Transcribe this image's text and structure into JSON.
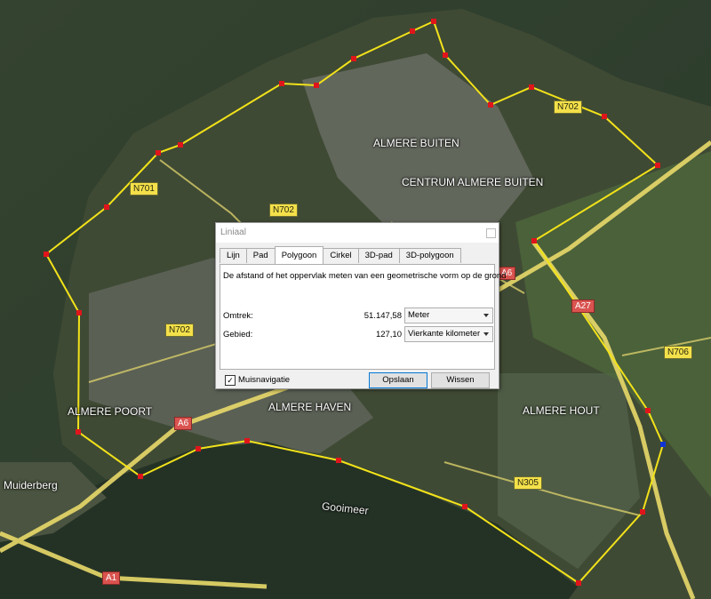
{
  "map": {
    "places": [
      {
        "id": "almere-buiten",
        "text": "ALMERE BUITEN"
      },
      {
        "id": "centrum-almere-buiten",
        "text": "CENTRUM ALMERE BUITEN"
      },
      {
        "id": "almere-poort",
        "text": "ALMERE POORT"
      },
      {
        "id": "almere-haven",
        "text": "ALMERE HAVEN"
      },
      {
        "id": "almere-hout",
        "text": "ALMERE HOUT"
      },
      {
        "id": "muiderberg",
        "text": "Muiderberg"
      },
      {
        "id": "gooimeer",
        "text": "Gooimeer"
      }
    ],
    "roads": [
      {
        "id": "n701",
        "text": "N701"
      },
      {
        "id": "n702-a",
        "text": "N702"
      },
      {
        "id": "n702-b",
        "text": "N702"
      },
      {
        "id": "n702-c",
        "text": "N702"
      },
      {
        "id": "a6-a",
        "text": "A6"
      },
      {
        "id": "a6-b",
        "text": "A6"
      },
      {
        "id": "a27",
        "text": "A27"
      },
      {
        "id": "n706",
        "text": "N706"
      },
      {
        "id": "n305",
        "text": "N305"
      },
      {
        "id": "a1",
        "text": "A1"
      }
    ],
    "polygon_color": "#f2e21a",
    "vertex_color": "#e0151b",
    "selected_vertex_color": "#1033d6"
  },
  "dialog": {
    "title": "Liniaal",
    "tabs": [
      "Lijn",
      "Pad",
      "Polygoon",
      "Cirkel",
      "3D-pad",
      "3D-polygoon"
    ],
    "active_tab": "Polygoon",
    "description": "De afstand of het oppervlak meten van een geometrische vorm op de grond",
    "perimeter": {
      "label": "Omtrek:",
      "value": "51.147,58",
      "unit": "Meter"
    },
    "area": {
      "label": "Gebied:",
      "value": "127,10",
      "unit": "Vierkante kilometer"
    },
    "mouse_nav": {
      "label": "Muisnavigatie",
      "checked": "✓"
    },
    "save_label": "Opslaan",
    "clear_label": "Wissen"
  }
}
